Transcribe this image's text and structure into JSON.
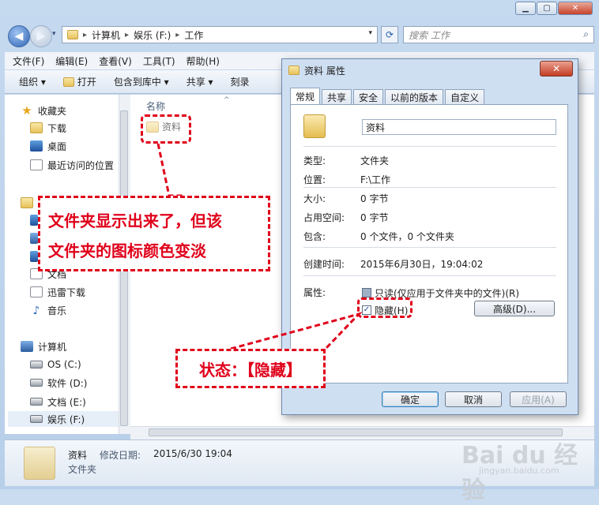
{
  "explorer": {
    "address": {
      "segments": [
        "计算机",
        "娱乐 (F:)",
        "工作"
      ],
      "separator": "▸"
    },
    "search_placeholder": "搜索 工作",
    "menu": [
      "文件(F)",
      "编辑(E)",
      "查看(V)",
      "工具(T)",
      "帮助(H)"
    ],
    "toolbar": {
      "organize": "组织 ▾",
      "open": "打开",
      "include": "包含到库中 ▾",
      "share": "共享 ▾",
      "burn": "刻录"
    },
    "nav": {
      "favorites": "收藏夹",
      "downloads": "下载",
      "desktop": "桌面",
      "recent": "最近访问的位置",
      "documents": "文档",
      "thunder": "迅雷下载",
      "music": "音乐",
      "computer": "计算机",
      "drive_c": "OS (C:)",
      "drive_d": "软件 (D:)",
      "drive_e": "文档 (E:)",
      "drive_f": "娱乐 (F:)"
    },
    "column_header": "名称",
    "file_item": "资料",
    "details": {
      "name": "资料",
      "modified_label": "修改日期:",
      "modified_value": "2015/6/30 19:04",
      "type": "文件夹"
    }
  },
  "dialog": {
    "title": "资料 属性",
    "tabs": [
      "常规",
      "共享",
      "安全",
      "以前的版本",
      "自定义"
    ],
    "name_value": "资料",
    "rows": [
      {
        "label": "类型:",
        "value": "文件夹"
      },
      {
        "label": "位置:",
        "value": "F:\\工作"
      },
      {
        "label": "大小:",
        "value": "0 字节"
      },
      {
        "label": "占用空间:",
        "value": "0 字节"
      },
      {
        "label": "包含:",
        "value": "0 个文件，0 个文件夹"
      },
      {
        "label": "创建时间:",
        "value": "2015年6月30日，19:04:02"
      }
    ],
    "attributes_label": "属性:",
    "readonly_label": "只读(仅应用于文件夹中的文件)(R)",
    "hidden_label": "隐藏(H)",
    "advanced_button": "高级(D)...",
    "ok_button": "确定",
    "cancel_button": "取消",
    "apply_button": "应用(A)",
    "hidden_checked_mark": "✓"
  },
  "annotations": {
    "callout1_line1": "文件夹显示出来了，但该",
    "callout1_line2": "文件夹的图标颜色变淡",
    "callout2": "状态：【隐藏】",
    "color": "#e0001a"
  },
  "watermark": {
    "brand": "Bai du 经验",
    "url": "jingyan.baidu.com"
  }
}
